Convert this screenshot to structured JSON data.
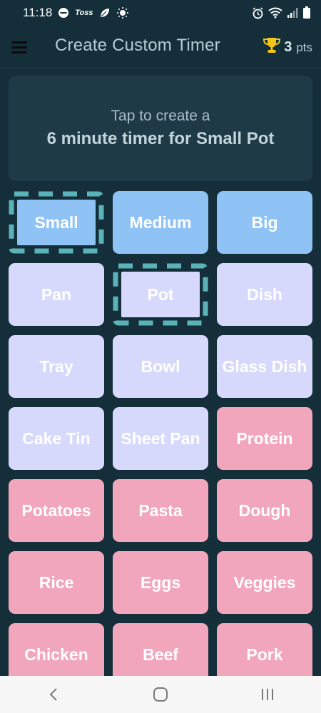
{
  "status": {
    "time": "11:18",
    "notification_icons": [
      "do-not-disturb-icon",
      "toss-app-icon",
      "leaf-icon",
      "brightness-icon"
    ],
    "system_icons": [
      "alarm-icon",
      "wifi-icon",
      "signal-icon",
      "battery-icon"
    ],
    "toss_label": "Toss"
  },
  "app_bar": {
    "title": "Create Custom Timer",
    "points_value": "3",
    "points_unit": "pts",
    "menu_icon": "menu-icon",
    "trophy_icon": "trophy-icon",
    "trophy_color": "#f5c518"
  },
  "prompt": {
    "line1": "Tap to create a",
    "line2": "6 minute timer for Small Pot"
  },
  "tiles": [
    {
      "label": "Small",
      "kind": "size",
      "selected": true
    },
    {
      "label": "Medium",
      "kind": "size",
      "selected": false
    },
    {
      "label": "Big",
      "kind": "size",
      "selected": false
    },
    {
      "label": "Pan",
      "kind": "vessel",
      "selected": false
    },
    {
      "label": "Pot",
      "kind": "vessel",
      "selected": true
    },
    {
      "label": "Dish",
      "kind": "vessel",
      "selected": false
    },
    {
      "label": "Tray",
      "kind": "vessel",
      "selected": false
    },
    {
      "label": "Bowl",
      "kind": "vessel",
      "selected": false
    },
    {
      "label": "Glass Dish",
      "kind": "vessel",
      "selected": false
    },
    {
      "label": "Cake Tin",
      "kind": "vessel",
      "selected": false
    },
    {
      "label": "Sheet Pan",
      "kind": "vessel",
      "selected": false
    },
    {
      "label": "Protein",
      "kind": "food",
      "selected": false
    },
    {
      "label": "Potatoes",
      "kind": "food",
      "selected": false
    },
    {
      "label": "Pasta",
      "kind": "food",
      "selected": false
    },
    {
      "label": "Dough",
      "kind": "food",
      "selected": false
    },
    {
      "label": "Rice",
      "kind": "food",
      "selected": false
    },
    {
      "label": "Eggs",
      "kind": "food",
      "selected": false
    },
    {
      "label": "Veggies",
      "kind": "food",
      "selected": false
    },
    {
      "label": "Chicken",
      "kind": "food",
      "selected": false
    },
    {
      "label": "Beef",
      "kind": "food",
      "selected": false
    },
    {
      "label": "Pork",
      "kind": "food",
      "selected": false
    }
  ],
  "colors": {
    "background": "#142f3a",
    "size_tile": "#8fc3f5",
    "vessel_tile": "#d6d9fb",
    "food_tile": "#f2a6bb",
    "selection_dash": "#5ab3b8"
  },
  "nav": {
    "back_icon": "back-icon",
    "home_icon": "home-icon",
    "recents_icon": "recents-icon"
  }
}
